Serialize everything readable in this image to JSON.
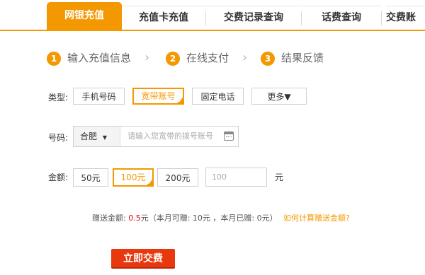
{
  "tabs": {
    "active": "网银充值",
    "items": [
      "充值卡充值",
      "交费记录查询",
      "话费查询",
      "交费账"
    ]
  },
  "steps": [
    {
      "num": "1",
      "label": "输入充值信息"
    },
    {
      "num": "2",
      "label": "在线支付"
    },
    {
      "num": "3",
      "label": "结果反馈"
    }
  ],
  "type_row": {
    "label": "类型:",
    "options": [
      "手机号码",
      "宽带账号",
      "固定电话",
      "更多▼"
    ],
    "selected": "宽带账号"
  },
  "number_row": {
    "label": "号码:",
    "city": "合肥",
    "placeholder": "请输入您宽带的拨号账号"
  },
  "amount_row": {
    "label": "金额:",
    "options": [
      "50元",
      "100元",
      "200元"
    ],
    "selected": "100元",
    "custom_placeholder": "100",
    "unit": "元"
  },
  "bonus": {
    "prefix": "赠送金额:",
    "amount": "0.5",
    "suffix": "元（本月可赠: 10元 ，本月已赠: 0元）",
    "link": "如何计算赠送金额?"
  },
  "submit_label": "立即交费",
  "colors": {
    "accent": "#f39800",
    "submit": "#e8380d",
    "highlight": "#e60012"
  }
}
